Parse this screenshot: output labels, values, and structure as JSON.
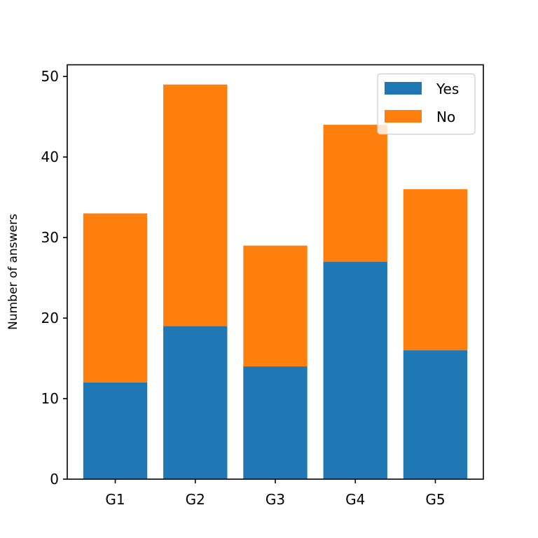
{
  "chart_data": {
    "type": "bar",
    "stacked": true,
    "title": "",
    "xlabel": "",
    "ylabel": "Number of answers",
    "categories": [
      "G1",
      "G2",
      "G3",
      "G4",
      "G5"
    ],
    "series": [
      {
        "name": "Yes",
        "color": "#1f77b4",
        "values": [
          12,
          19,
          14,
          27,
          16
        ]
      },
      {
        "name": "No",
        "color": "#ff7f0e",
        "values": [
          21,
          30,
          15,
          17,
          20
        ]
      }
    ],
    "ylim": [
      0,
      51.45
    ],
    "yticks": [
      0,
      10,
      20,
      30,
      40,
      50
    ],
    "grid": false,
    "legend": {
      "position": "top-right",
      "entries": [
        "Yes",
        "No"
      ]
    }
  }
}
